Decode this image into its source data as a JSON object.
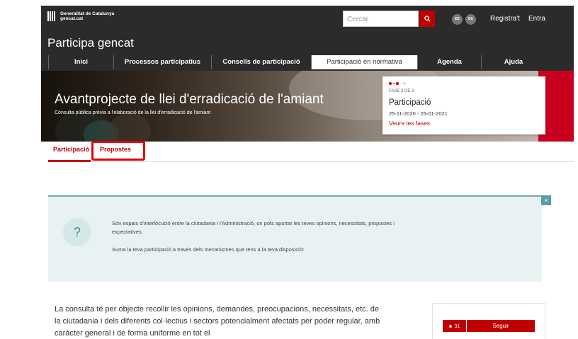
{
  "header": {
    "logo_line1": "Generalitat de Catalunya",
    "logo_line2": "gencat.cat",
    "search_placeholder": "Cercar",
    "search_icon": "search-icon",
    "languages": [
      "ES",
      "OC"
    ],
    "register_label": "Registra't",
    "login_label": "Entra",
    "site_title": "Participa gencat"
  },
  "nav": {
    "items": [
      {
        "label": "Inici"
      },
      {
        "label": "Processos participatius"
      },
      {
        "label": "Consells de participació"
      },
      {
        "label": "Participació en normativa"
      },
      {
        "label": "Agenda"
      },
      {
        "label": "Ajuda"
      }
    ],
    "active_index": 3
  },
  "hero": {
    "title": "Avantprojecte de llei d'erradicació de l'amiant",
    "subtitle": "Consulta pública prèvia a l'elaboració de la llei d'erradicació de l'amiant"
  },
  "phase": {
    "step_label": "FASE 2 DE 3",
    "name": "Participació",
    "dates": "25-11-2020 - 25-01-2021",
    "link_label": "Veure les fases"
  },
  "tabs": {
    "items": [
      {
        "label": "Participació"
      },
      {
        "label": "Propostes"
      }
    ],
    "active_index": 0
  },
  "callout": {
    "icon": "question-icon",
    "icon_glyph": "?",
    "close_glyph": "×",
    "line1": "Són espais d'interlocució entre la ciutadania i l'Administració, on pots aportar les teves opinions, necessitats, propostes i",
    "line2": "expectatives.",
    "line3": "Suma la teva participació a través dels mecanismes que tens a la teva disposició!"
  },
  "body": {
    "paragraph": "La consulta té per objecte recollir les opinions, demandes, preocupacions, necessitats, etc. de la ciutadania i dels diferents col·lectius i sectors potencialment afectats per poder regular, amb caràcter general i de forma uniforme en tot el"
  },
  "follow": {
    "count": "31",
    "count_icon": "bell-icon",
    "button_label": "Seguir"
  },
  "colors": {
    "brand_red": "#c00000",
    "header_dark": "#2b2b2b",
    "callout_bg": "#e8f2f3",
    "callout_accent": "#5b9ea5",
    "highlight_red": "#e3000f"
  }
}
